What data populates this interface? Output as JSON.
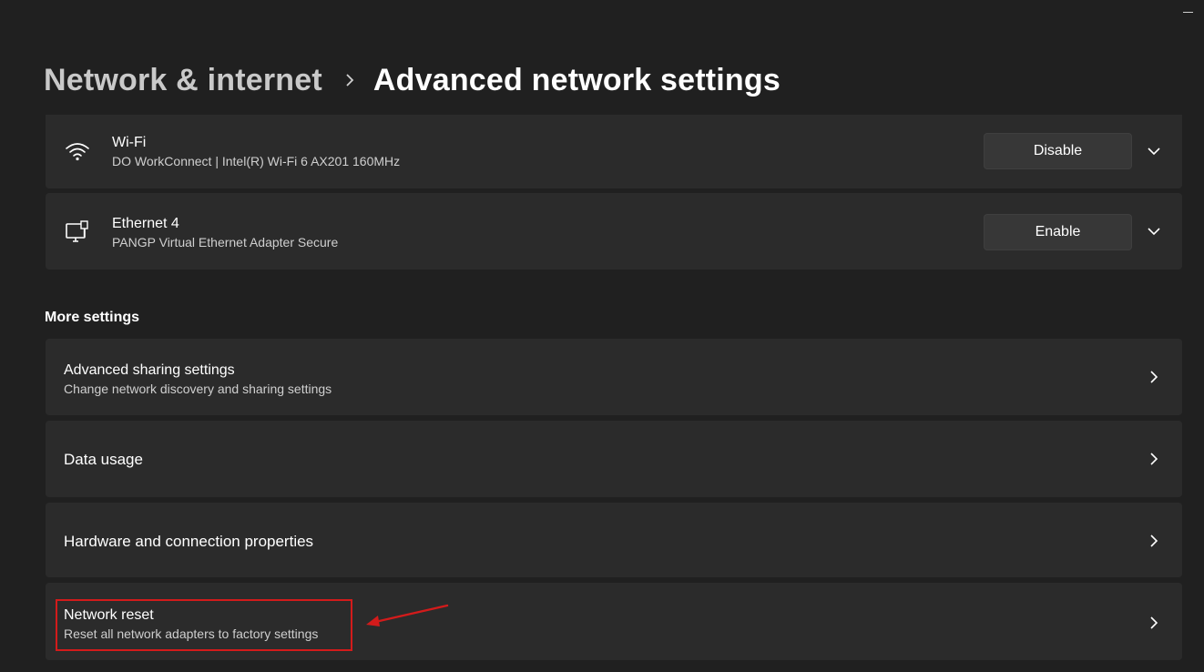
{
  "breadcrumb": {
    "parent": "Network & internet",
    "current": "Advanced network settings"
  },
  "adapters": [
    {
      "icon": "wifi-icon",
      "name": "Wi-Fi",
      "description": "DO WorkConnect | Intel(R) Wi-Fi 6 AX201 160MHz",
      "action_label": "Disable"
    },
    {
      "icon": "ethernet-icon",
      "name": "Ethernet 4",
      "description": "PANGP Virtual Ethernet Adapter Secure",
      "action_label": "Enable"
    }
  ],
  "more_settings": {
    "label": "More settings",
    "items": [
      {
        "title": "Advanced sharing settings",
        "subtitle": "Change network discovery and sharing settings"
      },
      {
        "title": "Data usage"
      },
      {
        "title": "Hardware and connection properties"
      },
      {
        "title": "Network reset",
        "subtitle": "Reset all network adapters to factory settings",
        "highlighted": true
      }
    ]
  },
  "colors": {
    "background": "#202020",
    "card": "#2b2b2b",
    "annotation": "#d31b1b"
  }
}
